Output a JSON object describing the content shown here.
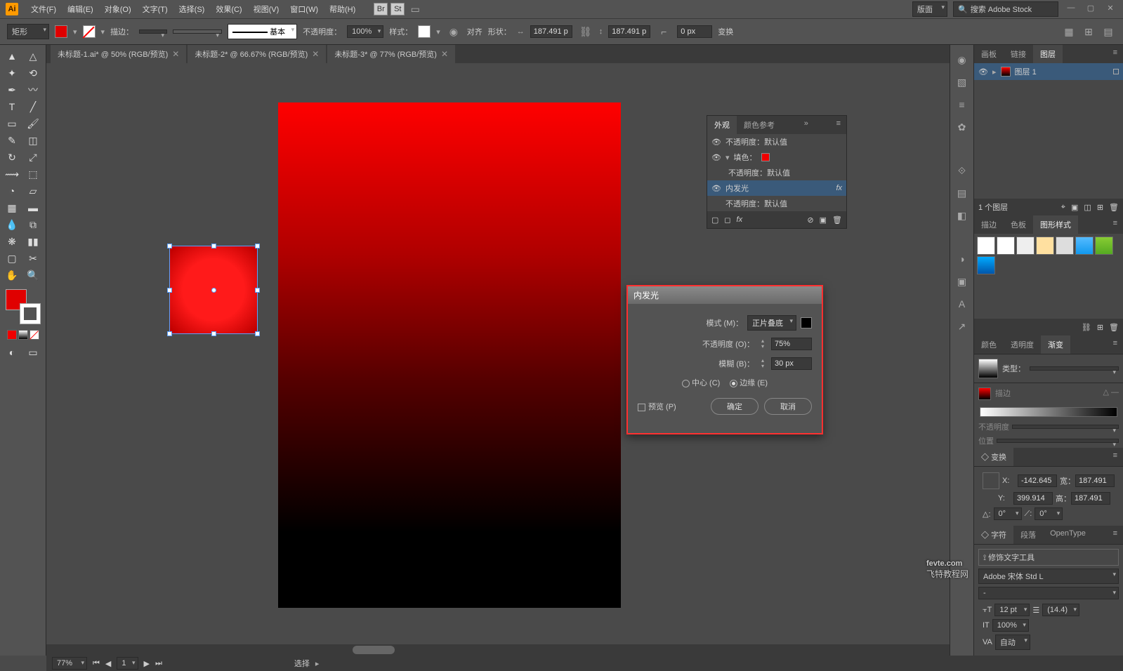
{
  "menu": [
    "文件(F)",
    "编辑(E)",
    "对象(O)",
    "文字(T)",
    "选择(S)",
    "效果(C)",
    "视图(V)",
    "窗口(W)",
    "帮助(H)"
  ],
  "menu_icons_r": [
    "Br",
    "St"
  ],
  "workspace": "版面",
  "search_ph": "搜索 Adobe Stock",
  "control": {
    "shape": "矩形",
    "fill": "#e00000",
    "stroke_label": "描边：",
    "style_label": "基本",
    "opacity_label": "不透明度：",
    "opacity": "100%",
    "style2": "样式：",
    "align": "对齐",
    "shape2": "形状：",
    "w": "187.491 p",
    "h": "187.491 p",
    "corner": "0 px",
    "trans": "变换"
  },
  "tabs": [
    {
      "t": "未标题-1.ai* @ 50% (RGB/预览)",
      "a": false
    },
    {
      "t": "未标题-2* @ 66.67% (RGB/预览)",
      "a": false
    },
    {
      "t": "未标题-3* @ 77% (RGB/预览)",
      "a": true
    }
  ],
  "dialog": {
    "title": "内发光",
    "mode_l": "模式 (M)：",
    "mode": "正片叠底",
    "opac_l": "不透明度 (O)：",
    "opac": "75%",
    "blur_l": "模糊 (B)：",
    "blur": "30 px",
    "center": "中心 (C)",
    "edge": "边缘 (E)",
    "preview": "预览 (P)",
    "ok": "确定",
    "cancel": "取消"
  },
  "layers": {
    "tabs": [
      "画板",
      "链接",
      "图层"
    ],
    "row": "图层 1",
    "footer": "1 个图层"
  },
  "appearance": {
    "tabs": [
      "外观",
      "颜色参考"
    ],
    "rows": [
      "不透明度：默认值",
      "填色：",
      "不透明度：默认值",
      "内发光",
      "不透明度：默认值"
    ]
  },
  "gfx_tabs": [
    "描边",
    "色板",
    "图形样式"
  ],
  "grad_tabs": [
    "颜色",
    "透明度",
    "渐变"
  ],
  "grad_type": "类型：",
  "grad_opac": "不透明度",
  "grad_pos": "位置",
  "transform": {
    "t": "变换",
    "x": "-142.645",
    "y": "399.914",
    "w": "187.491",
    "h": "187.491",
    "wl": "宽：",
    "hl": "高：",
    "ang": "0°"
  },
  "char": {
    "tabs": [
      "字符",
      "段落",
      "OpenType"
    ],
    "touch": "修饰文字工具",
    "font": "Adobe 宋体 Std L",
    "size": "12 pt",
    "lead": "(14.4)",
    "scale": "100%",
    "track": "自动"
  },
  "status": {
    "zoom": "77%",
    "page": "1",
    "sel": "选择"
  },
  "watermark": {
    "a": "fevte.com",
    "b": "飞特教程网"
  }
}
